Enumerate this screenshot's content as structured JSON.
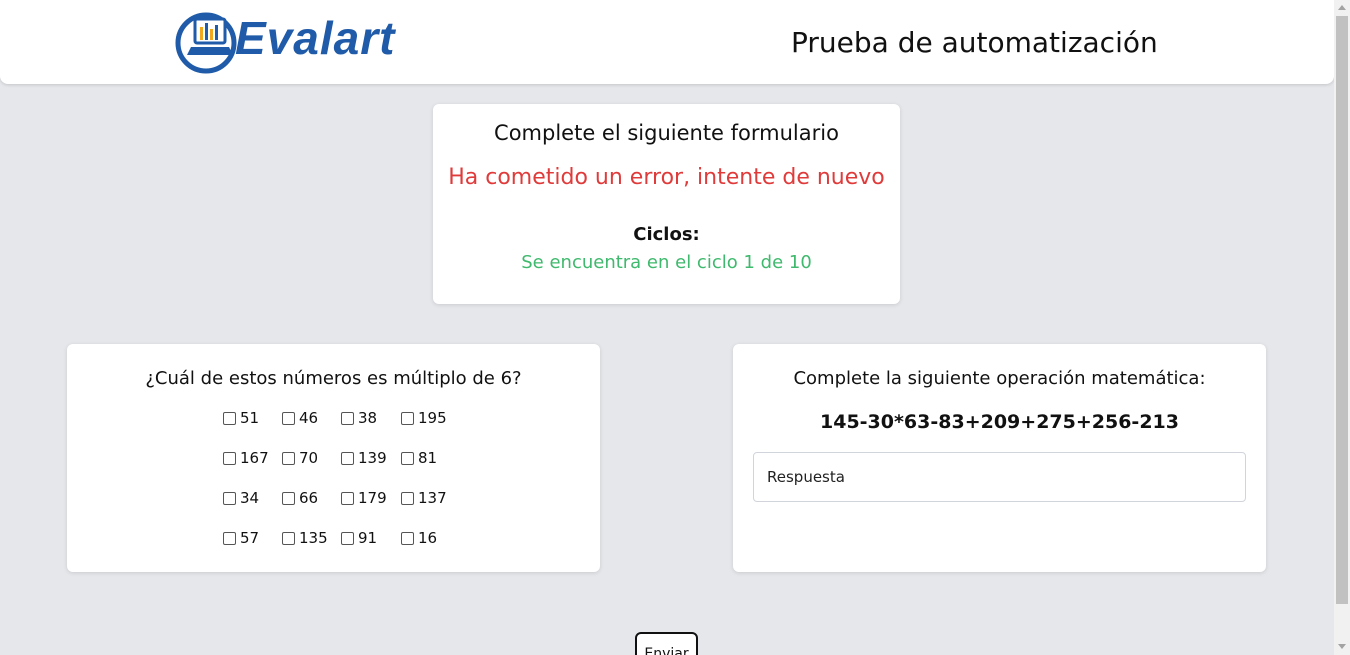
{
  "header": {
    "logo_text": "Evalart",
    "title": "Prueba de automatización"
  },
  "status": {
    "title": "Complete el siguiente formulario",
    "error": "Ha cometido un error, intente de nuevo",
    "cycles_label": "Ciclos:",
    "cycles_value": "Se encuentra en el ciclo 1 de 10"
  },
  "question": {
    "title": "¿Cuál de estos números es múltiplo de 6?",
    "options": [
      "51",
      "46",
      "38",
      "195",
      "167",
      "70",
      "139",
      "81",
      "34",
      "66",
      "179",
      "137",
      "57",
      "135",
      "91",
      "16"
    ]
  },
  "operation": {
    "title": "Complete la siguiente operación matemática:",
    "expression": "145-30*63-83+209+275+256-213",
    "answer_placeholder": "Respuesta",
    "answer_value": ""
  },
  "submit_label": "Enviar",
  "colors": {
    "brand": "#1f5ba8",
    "error": "#e03b3b",
    "success": "#3fb96d",
    "background": "#e5e7eb"
  }
}
